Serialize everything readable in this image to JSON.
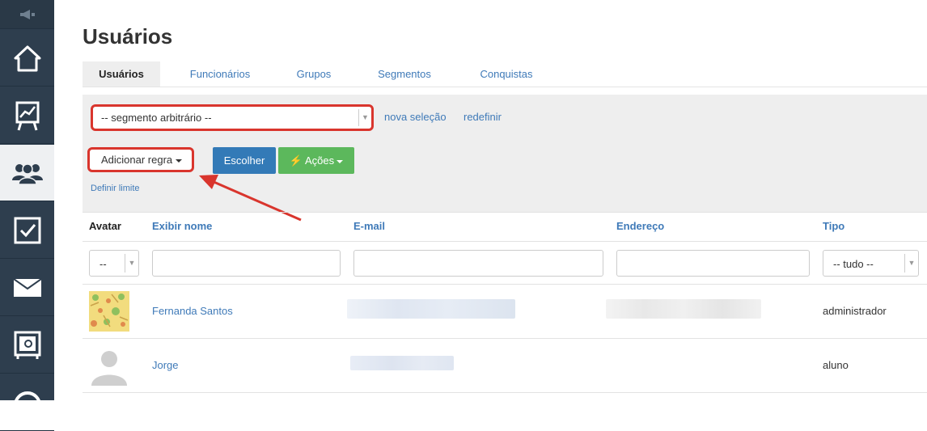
{
  "page": {
    "title": "Usuários"
  },
  "sidebar": {
    "items": [
      {
        "name": "announcements",
        "icon": "megaphone-icon"
      },
      {
        "name": "home",
        "icon": "home-icon"
      },
      {
        "name": "reports",
        "icon": "chart-board-icon"
      },
      {
        "name": "users",
        "icon": "users-icon",
        "active": true
      },
      {
        "name": "tasks",
        "icon": "checkbox-icon"
      },
      {
        "name": "messages",
        "icon": "envelope-icon"
      },
      {
        "name": "safe",
        "icon": "safe-icon"
      },
      {
        "name": "more",
        "icon": "dollar-icon"
      }
    ]
  },
  "tabs": [
    {
      "label": "Usuários",
      "active": true
    },
    {
      "label": "Funcionários"
    },
    {
      "label": "Grupos"
    },
    {
      "label": "Segmentos"
    },
    {
      "label": "Conquistas"
    }
  ],
  "filters": {
    "segment_value": "-- segmento arbitrário --",
    "new_selection": "nova seleção",
    "reset": "redefinir",
    "add_rule": "Adicionar regra",
    "choose": "Escolher",
    "actions": "Ações",
    "set_limit": "Definir limite"
  },
  "table": {
    "headers": [
      "Avatar",
      "Exibir nome",
      "E-mail",
      "Endereço",
      "Tipo"
    ],
    "avatar_filter": "--",
    "type_filter": "-- tudo --",
    "rows": [
      {
        "name": "Fernanda Santos",
        "type": "administrador",
        "avatar": "pattern"
      },
      {
        "name": "Jorge",
        "type": "aluno",
        "avatar": "placeholder"
      }
    ]
  },
  "colors": {
    "sidebar": "#2e3e4e",
    "link": "#3f7ab8",
    "primary": "#337ab7",
    "success": "#5cb85c",
    "highlight": "#d9352d"
  }
}
